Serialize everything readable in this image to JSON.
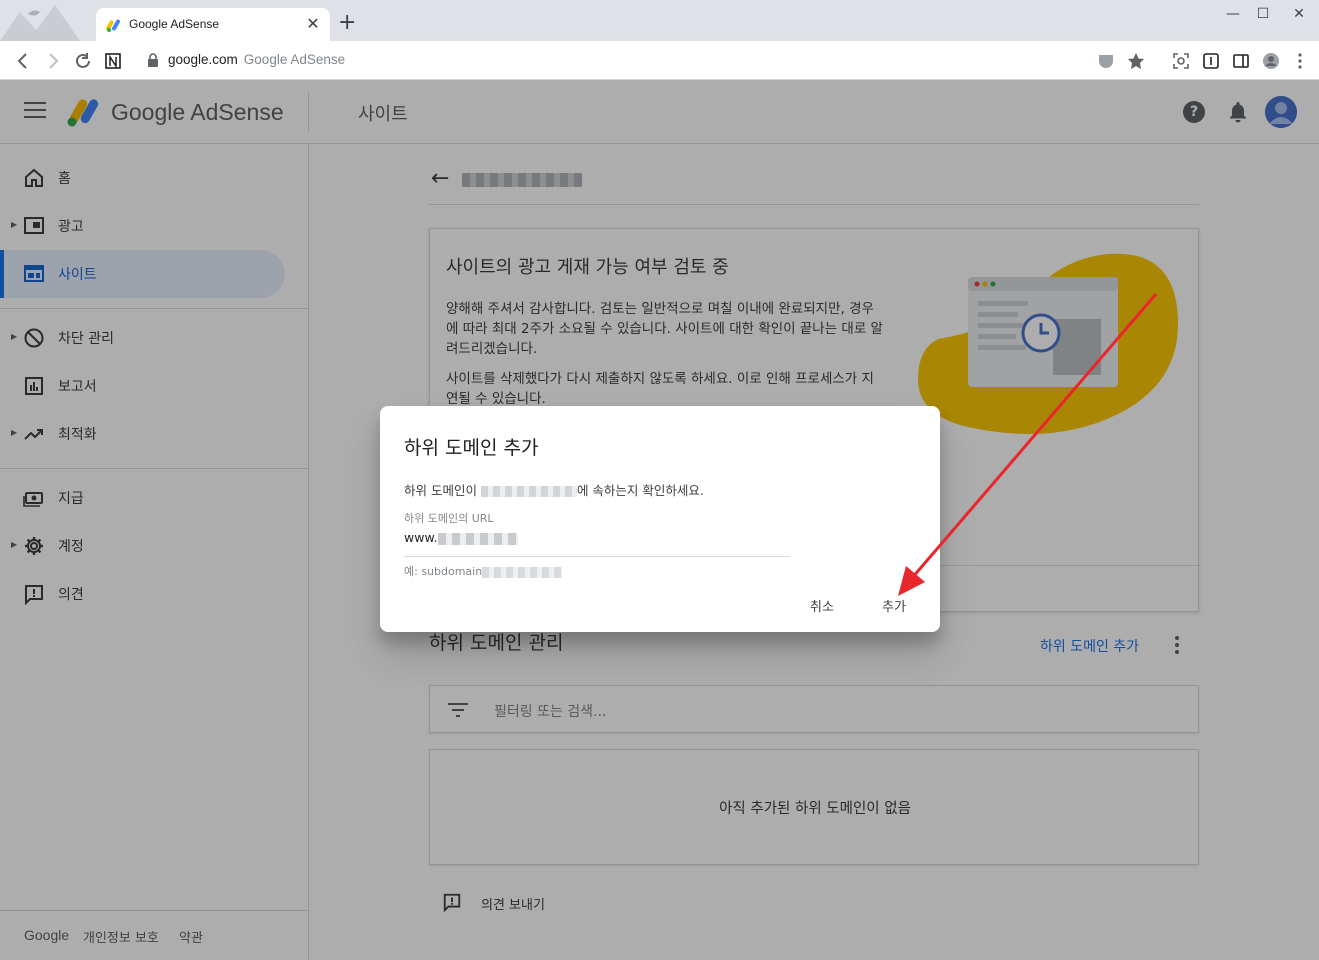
{
  "browser": {
    "tab_title": "Google AdSense",
    "new_tab": "+",
    "close_tab": "✕",
    "url_host": "google.com",
    "url_title": "Google AdSense",
    "min": "—",
    "max": "☐",
    "close": "✕"
  },
  "header": {
    "brand": "Google AdSense",
    "section_title": "사이트"
  },
  "sidebar": {
    "items": [
      {
        "label": "홈"
      },
      {
        "label": "광고"
      },
      {
        "label": "사이트"
      },
      {
        "label": "차단 관리"
      },
      {
        "label": "보고서"
      },
      {
        "label": "최적화"
      },
      {
        "label": "지급"
      },
      {
        "label": "계정"
      },
      {
        "label": "의견"
      }
    ],
    "footer": {
      "google": "Google",
      "privacy": "개인정보 보호",
      "terms": "약관"
    }
  },
  "main": {
    "review": {
      "title": "사이트의 광고 게재 가능 여부 검토 중",
      "p1": "양해해 주셔서 감사합니다. 검토는 일반적으로 며칠 이내에 완료되지만, 경우에 따라 최대 2주가 소요될 수 있습니다. 사이트에 대한 확인이 끝나는 대로 알려드리겠습니다.",
      "p2": "사이트를 삭제했다가 다시 제출하지 않도록 하세요. 이로 인해 프로세스가 지연될 수 있습니다."
    },
    "subdomain": {
      "title": "하위 도메인 관리",
      "add_link": "하위 도메인 추가",
      "filter_placeholder": "필터링 또는 검색...",
      "empty": "아직 추가된 하위 도메인이 없음"
    },
    "feedback": "의견 보내기"
  },
  "dialog": {
    "title": "하위 도메인 추가",
    "msg_pre": "하위 도메인이 ",
    "msg_post": "에 속하는지 확인하세요.",
    "label": "하위 도메인의 URL",
    "value_prefix": "www.",
    "hint_prefix": "예: subdomain",
    "cancel": "취소",
    "add": "추가"
  },
  "colors": {
    "accent": "#1a73e8",
    "annotation": "#e8262c",
    "illustration": "#f9c606"
  }
}
